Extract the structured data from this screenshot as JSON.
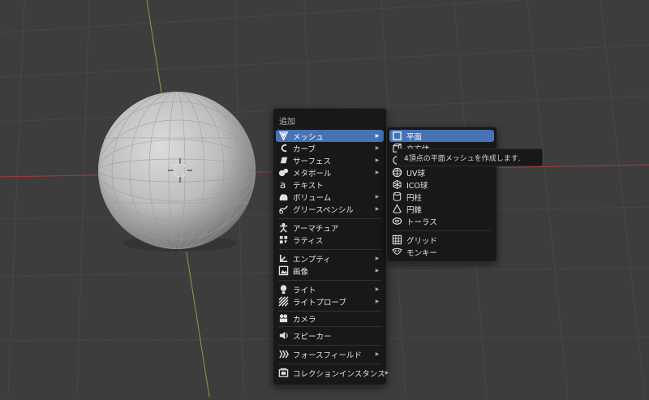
{
  "viewport": {
    "background": "#3d3d3d"
  },
  "menu": {
    "title": "追加",
    "items": [
      {
        "label": "メッシュ",
        "icon": "mesh-icon",
        "submenu": true,
        "active": true
      },
      {
        "label": "カーブ",
        "icon": "curve-icon",
        "submenu": true
      },
      {
        "label": "サーフェス",
        "icon": "surface-icon",
        "submenu": true
      },
      {
        "label": "メタボール",
        "icon": "metaball-icon",
        "submenu": true
      },
      {
        "label": "テキスト",
        "icon": "text-icon",
        "submenu": false
      },
      {
        "label": "ボリューム",
        "icon": "volume-icon",
        "submenu": true
      },
      {
        "label": "グリースペンシル",
        "icon": "grease-pencil-icon",
        "submenu": true
      },
      {
        "label": "アーマチュア",
        "icon": "armature-icon",
        "submenu": false
      },
      {
        "label": "ラティス",
        "icon": "lattice-icon",
        "submenu": false
      },
      {
        "label": "エンプティ",
        "icon": "empty-icon",
        "submenu": true
      },
      {
        "label": "画像",
        "icon": "image-icon",
        "submenu": true
      },
      {
        "label": "ライト",
        "icon": "light-icon",
        "submenu": true
      },
      {
        "label": "ライトプローブ",
        "icon": "light-probe-icon",
        "submenu": true
      },
      {
        "label": "カメラ",
        "icon": "camera-icon",
        "submenu": false
      },
      {
        "label": "スピーカー",
        "icon": "speaker-icon",
        "submenu": false
      },
      {
        "label": "フォースフィールド",
        "icon": "force-field-icon",
        "submenu": true
      },
      {
        "label": "コレクションインスタンス",
        "icon": "collection-instance-icon",
        "submenu": true
      }
    ]
  },
  "submenu": {
    "items": [
      {
        "label": "平面",
        "icon": "plane-icon",
        "active": true
      },
      {
        "label": "立方体",
        "icon": "cube-icon"
      },
      {
        "label": "円",
        "icon": "circle-icon"
      },
      {
        "label": "UV球",
        "icon": "uv-sphere-icon"
      },
      {
        "label": "ICO球",
        "icon": "ico-sphere-icon"
      },
      {
        "label": "円柱",
        "icon": "cylinder-icon"
      },
      {
        "label": "円錐",
        "icon": "cone-icon"
      },
      {
        "label": "トーラス",
        "icon": "torus-icon"
      },
      {
        "label": "グリッド",
        "icon": "grid-icon"
      },
      {
        "label": "モンキー",
        "icon": "monkey-icon"
      }
    ]
  },
  "tooltip": {
    "text": "4頂点の平面メッシュを作成します."
  },
  "colors": {
    "accent": "#4772b3",
    "menu_bg": "#181818",
    "x_axis": "#a83a3a",
    "y_axis": "#8aa040"
  }
}
